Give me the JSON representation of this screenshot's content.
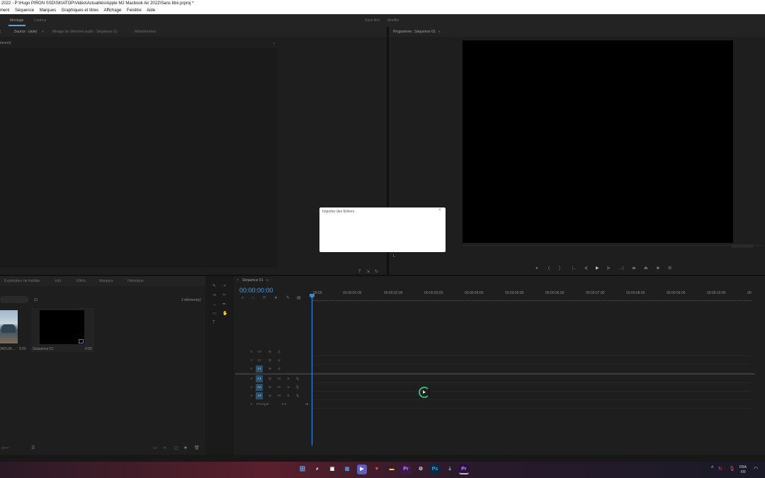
{
  "window": {
    "title": "2022 - P:\\Hugo PIRON SSD\\SKIATOP\\Vidéo\\Actualités\\Apple M2 Macbook Air 2022\\Sans titre.prproj *"
  },
  "menu": {
    "items": [
      "ment",
      "Séquence",
      "Marques",
      "Graphiques et titres",
      "Affichage",
      "Fenêtre",
      "Aide"
    ]
  },
  "workspaces": {
    "left": [
      "Montage",
      "Couleur"
    ],
    "right": [
      "Sans titre",
      "Modifié"
    ]
  },
  "source_panel": {
    "tabs": [
      "Source : (vide)",
      "Mixage de l'élément audio : Séquence 01",
      "Métadonnées"
    ],
    "sub_header": "ément)"
  },
  "program_panel": {
    "tab": "Programme : Séquence 01"
  },
  "project_panel": {
    "tabs": [
      "Explorateur de médias",
      "Info",
      "Effets",
      "Marques",
      "Historique"
    ],
    "items_count": "2 élément(s)",
    "items": [
      {
        "name": "342134...",
        "duration": "5:00"
      },
      {
        "name": "Séquence 01",
        "duration": "0:00"
      }
    ]
  },
  "timeline": {
    "tab": "Séquence 01",
    "timecode": "00:00:00:00",
    "ruler": [
      "00:00",
      "00:00:01:00",
      "00:00:02:00",
      "00:00:03:00",
      "00:00:04:00",
      "00:00:05:00",
      "00:00:06:00",
      "00:00:07:00",
      "00:00:08:00",
      "00:00:09:00",
      "00:00:10:00",
      "00:"
    ],
    "video_tracks": [
      "V3",
      "V2",
      "V1"
    ],
    "audio_tracks": [
      "A1",
      "A2",
      "A3"
    ],
    "master_label": "Principal",
    "master_value": "0,0"
  },
  "dialog": {
    "title": "Importer des fichiers"
  },
  "taskbar": {
    "lang_top": "FRA",
    "lang_bottom": "FR"
  },
  "colors": {
    "accent": "#2d8ceb",
    "panel_bg": "#1e1e1e",
    "track_blue": "#2a4f6b"
  }
}
